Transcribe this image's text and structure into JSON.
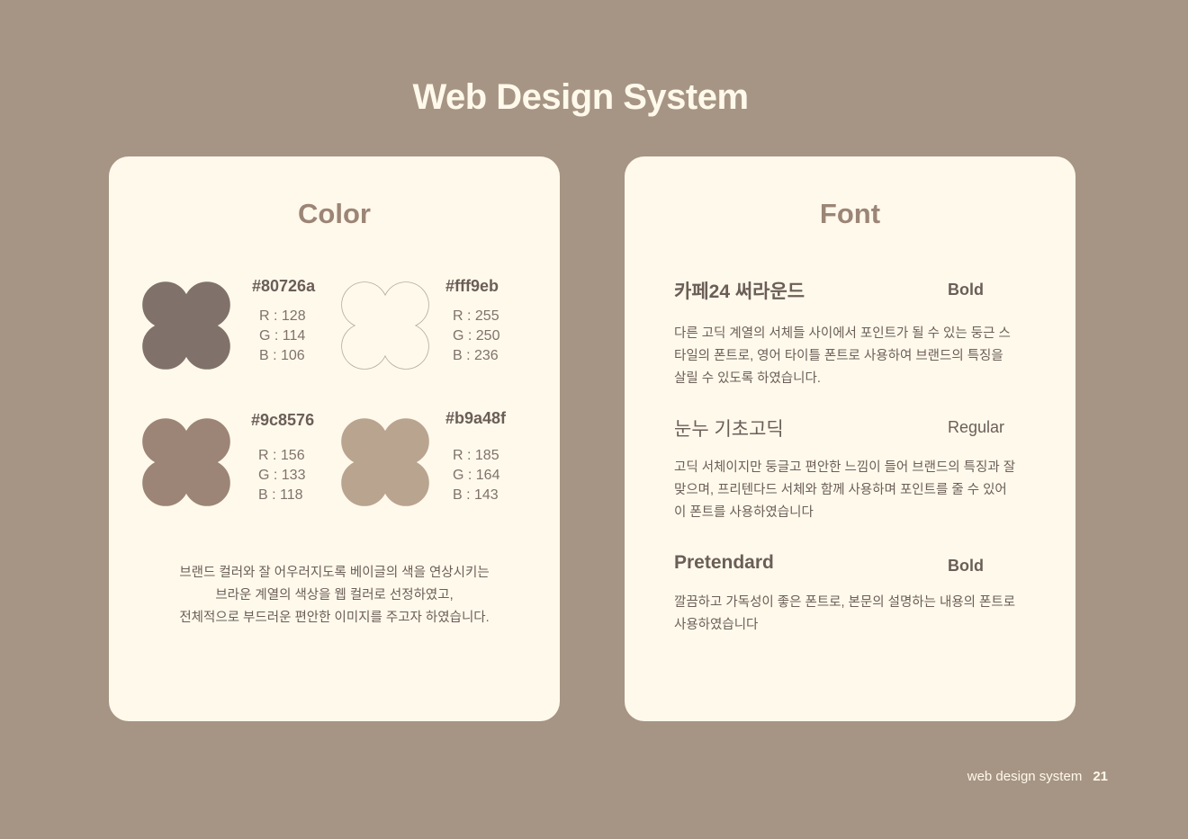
{
  "title": "Web Design System",
  "color": {
    "heading": "Color",
    "swatches": [
      {
        "hex": "#80726a",
        "r": "R : 128",
        "g": "G : 114",
        "b": "B : 106",
        "fill": "#80726a"
      },
      {
        "hex": "#fff9eb",
        "r": "R : 255",
        "g": "G : 250",
        "b": "B : 236",
        "fill": "#fff9eb"
      },
      {
        "hex": "#9c8576",
        "r": "R : 156",
        "g": "G : 133",
        "b": "B : 118",
        "fill": "#9c8576"
      },
      {
        "hex": "#b9a48f",
        "r": "R : 185",
        "g": "G : 164",
        "b": "B : 143",
        "fill": "#b9a48f"
      }
    ],
    "description": [
      "브랜드 컬러와 잘 어우러지도록 베이글의 색을 연상시키는",
      "브라운 계열의 색상을 웹 컬러로 선정하였고,",
      "전체적으로 부드러운 편안한 이미지를 주고자 하였습니다."
    ]
  },
  "font": {
    "heading": "Font",
    "fonts": [
      {
        "name": "카페24 써라운드",
        "weight": "Bold",
        "lines": [
          "다른 고딕 계열의 서체들 사이에서 포인트가 될 수 있는 둥근 스",
          "타일의 폰트로, 영어 타이틀 폰트로 사용하여 브랜드의 특징을",
          "살릴 수 있도록 하였습니다."
        ]
      },
      {
        "name": "눈누 기초고딕",
        "weight": "Regular",
        "lines": [
          "고딕 서체이지만 둥글고 편안한 느낌이 들어 브랜드의 특징과 잘",
          "맞으며, 프리텐다드 서체와 함께 사용하며 포인트를 줄 수 있어",
          "이 폰트를 사용하였습니다"
        ]
      },
      {
        "name": "Pretendard",
        "weight": "Bold",
        "lines": [
          "깔끔하고 가독성이 좋은 폰트로, 본문의 설명하는 내용의 폰트로",
          "사용하였습니다"
        ]
      }
    ]
  },
  "footer": {
    "label": "web design system",
    "page": "21"
  }
}
